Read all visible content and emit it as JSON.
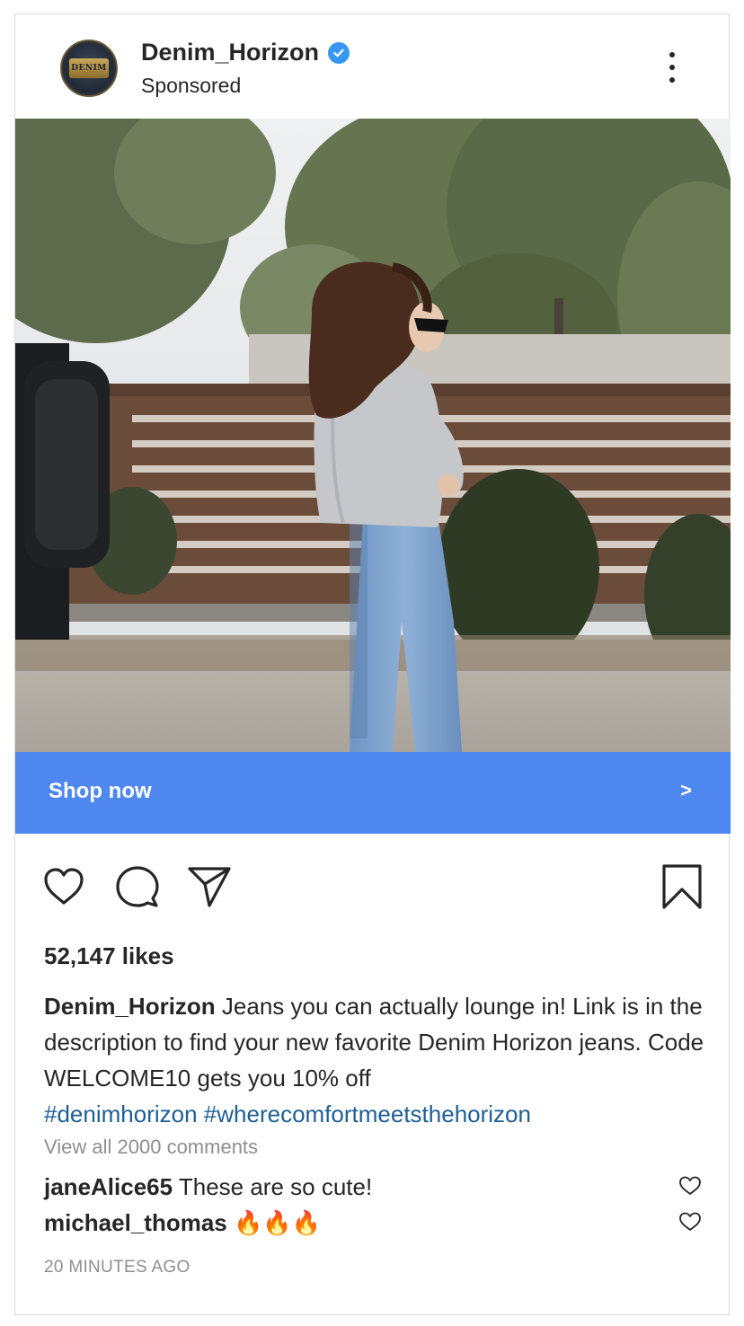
{
  "post": {
    "username": "Denim_Horizon",
    "sponsored_label": "Sponsored",
    "avatar_text": "DENIM",
    "verified_icon": "verified-check-icon",
    "more_icon": "more-vertical-icon"
  },
  "shop": {
    "label": "Shop now",
    "arrow": ">",
    "color": "#4f87f0"
  },
  "actions": {
    "icons": [
      "heart-icon",
      "comment-icon",
      "share-icon",
      "bookmark-icon"
    ]
  },
  "likes": "52,147 likes",
  "caption": {
    "user": "Denim_Horizon",
    "text": " Jeans you can actually lounge in! Link is in the description to find your new favorite Denim Horizon jeans. Code WELCOME10 gets you 10% off",
    "hashtags": [
      "#denimhorizon",
      "#wherecomfortmeetsthehorizon"
    ],
    "hashtag_color": "#1d5e95"
  },
  "view_all": "View all 2000 comments",
  "comments": [
    {
      "user": "janeAlice65",
      "text": " These are so cute!"
    },
    {
      "user": "michael_thomas",
      "text": " 🔥🔥🔥"
    }
  ],
  "timestamp": "20 MINUTES AGO"
}
